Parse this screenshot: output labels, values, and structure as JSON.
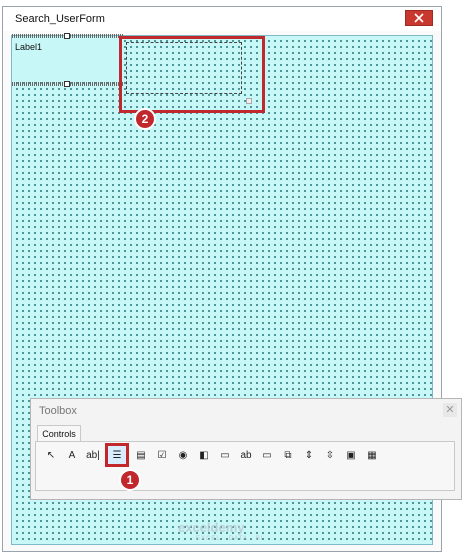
{
  "window": {
    "title": "Search_UserForm"
  },
  "userform": {
    "label_control": "Label1",
    "step2_badge": "2"
  },
  "toolbox": {
    "title": "Toolbox",
    "tab": "Controls",
    "tools": [
      {
        "name": "select-objects-icon",
        "glyph": "↖"
      },
      {
        "name": "label-icon",
        "glyph": "A"
      },
      {
        "name": "textbox-icon",
        "glyph": "ab|"
      },
      {
        "name": "combobox-icon",
        "glyph": "☰"
      },
      {
        "name": "listbox-icon",
        "glyph": "▤"
      },
      {
        "name": "checkbox-icon",
        "glyph": "☑"
      },
      {
        "name": "optionbutton-icon",
        "glyph": "◉"
      },
      {
        "name": "togglebutton-icon",
        "glyph": "◧"
      },
      {
        "name": "frame-icon",
        "glyph": "▭"
      },
      {
        "name": "commandbutton-icon",
        "glyph": "ab"
      },
      {
        "name": "tabstrip-icon",
        "glyph": "▭"
      },
      {
        "name": "multipage-icon",
        "glyph": "⧉"
      },
      {
        "name": "scrollbar-icon",
        "glyph": "⇕"
      },
      {
        "name": "spinbutton-icon",
        "glyph": "⇳"
      },
      {
        "name": "image-icon",
        "glyph": "▣"
      },
      {
        "name": "refedit-icon",
        "glyph": "▦"
      }
    ],
    "selected_tool_index": 3,
    "step1_badge": "1"
  },
  "watermark": {
    "brand": "exceldemy",
    "tagline": "EXCEL · DATA · BI"
  },
  "colors": {
    "highlight": "#c0282d",
    "canvas": "#c8f7f7"
  }
}
